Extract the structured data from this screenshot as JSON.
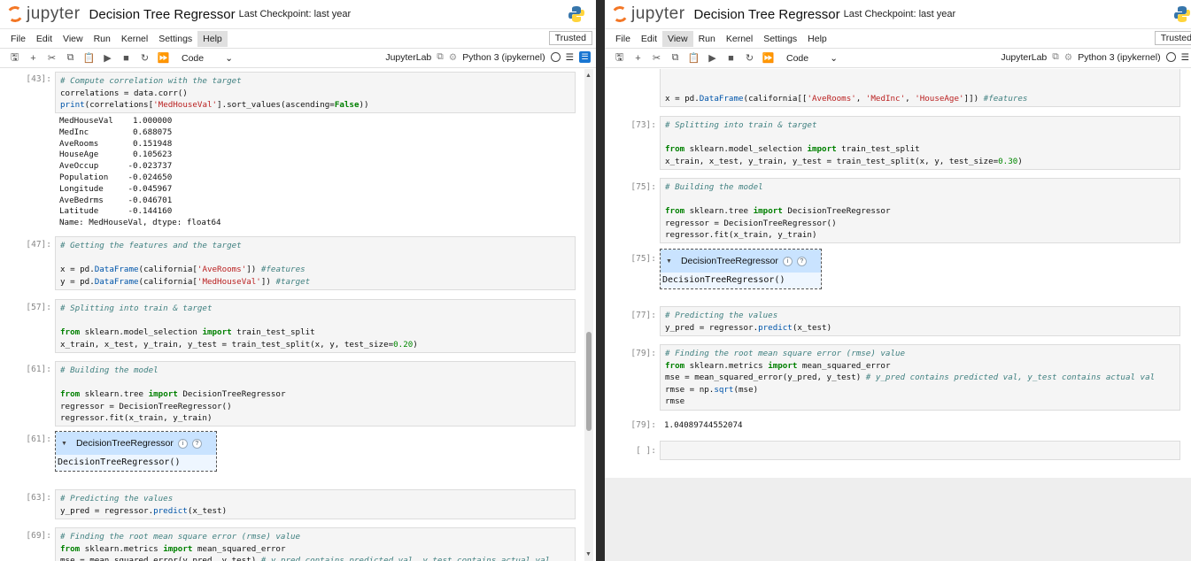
{
  "left": {
    "logo_text": "jupyter",
    "title": "Decision Tree Regressor",
    "checkpoint": "Last Checkpoint: last year",
    "menu": [
      "File",
      "Edit",
      "View",
      "Run",
      "Kernel",
      "Settings",
      "Help"
    ],
    "active_menu": "Help",
    "trusted": "Trusted",
    "cell_type": "Code",
    "jupyterlab": "JupyterLab",
    "kernel": "Python 3 (ipykernel)",
    "prompts": {
      "c43": "[43]:",
      "c47": "[47]:",
      "c57": "[57]:",
      "c61": "[61]:",
      "c61o": "[61]:",
      "c63": "[63]:",
      "c69": "[69]:"
    },
    "corr_output": "MedHouseVal    1.000000\nMedInc         0.688075\nAveRooms       0.151948\nHouseAge       0.105623\nAveOccup      -0.023737\nPopulation    -0.024650\nLongitude     -0.045967\nAveBedrms     -0.046701\nLatitude      -0.144160\nName: MedHouseVal, dtype: float64",
    "estimator_name": "DecisionTreeRegressor",
    "estimator_repr": "DecisionTreeRegressor()"
  },
  "right": {
    "logo_text": "jupyter",
    "title": "Decision Tree Regressor",
    "checkpoint": "Last Checkpoint: last year",
    "menu": [
      "File",
      "Edit",
      "View",
      "Run",
      "Kernel",
      "Settings",
      "Help"
    ],
    "active_menu": "View",
    "trusted": "Trusted",
    "cell_type": "Code",
    "jupyterlab": "JupyterLab",
    "kernel": "Python 3 (ipykernel)",
    "prompts": {
      "c73": "[73]:",
      "c75": "[75]:",
      "c75o": "[75]:",
      "c77": "[77]:",
      "c79": "[79]:",
      "c79o": "[79]:",
      "empty": "[ ]:"
    },
    "rmse_output": "1.04089744552074",
    "estimator_name": "DecisionTreeRegressor",
    "estimator_repr": "DecisionTreeRegressor()"
  }
}
